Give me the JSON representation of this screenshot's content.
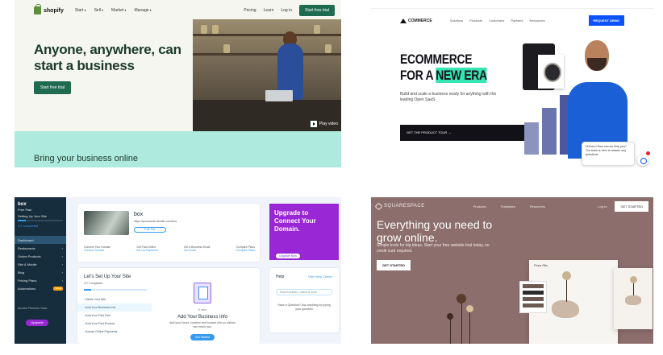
{
  "shopify": {
    "brand": "shopify",
    "nav": [
      "Start",
      "Sell",
      "Market",
      "Manage"
    ],
    "pricing": "Pricing",
    "learn": "Learn",
    "login": "Log in",
    "trial_small": "Start free trial",
    "headline": "Anyone, anywhere, can start a business",
    "cta": "Start free trial",
    "play": "Play video",
    "band": "Bring your business online",
    "colors": {
      "brand": "#5e8e3e",
      "button": "#1e6b52",
      "band": "#aeeade"
    }
  },
  "bigcommerce": {
    "brand": "COMMERCE",
    "nav": [
      "Solutions",
      "Products",
      "Customers",
      "Partners",
      "Resources"
    ],
    "demo": "REQUEST DEMO",
    "h1_line1": "ECOMMERCE",
    "h1_line2a": "FOR A ",
    "h1_line2b": "NEW ERA",
    "sub": "Build and scale a business ready for anything with the leading Open SaaS",
    "tour": "GET THE PRODUCT TOUR →",
    "chat": "Hi there! How can we help you? Our team is here to answer any questions.",
    "colors": {
      "accent": "#0d52ff",
      "highlight": "#36e4b4"
    }
  },
  "wix": {
    "site_name": "box",
    "site_sub": "Free Plan",
    "setup_label": "Setting Up Your Site",
    "setup_pct": "1/7 completed",
    "sidebar": [
      "Dashboard",
      "Restaurants",
      "Online Products",
      "Site & Mobile",
      "Blog",
      "Pricing Plans",
      "Automations"
    ],
    "sidebar_badge": "SALE",
    "premium": "Access Premium Tools",
    "upgrade": "Upgrade",
    "card_title": "box",
    "card_url": "https://yourname.wixsite.com/box",
    "edit_site": "Edit Site",
    "quick": [
      {
        "label": "Connect Your Domain",
        "link": "Connect Domain"
      },
      {
        "label": "Get Paid Online",
        "link": "Set Up Payments"
      },
      {
        "label": "Get a Business Email",
        "link": "Get Email"
      },
      {
        "label": "Compare Plans",
        "link": "Compare Plans"
      }
    ],
    "promo_title": "Upgrade to Connect Your Domain.",
    "promo_btn": "Upgrade Now",
    "setup_title": "Let's Set Up Your Site",
    "setup_progress": "1/7 Completed",
    "steps": [
      "Name Your Site",
      "Add Your Business Info",
      "Add Your First Post",
      "Add Your First Product",
      "Accept Online Payments"
    ],
    "content_kicker": "5 mins",
    "content_title": "Add Your Business Info",
    "content_desc": "Add your hours, location and contact info so visitors can reach you.",
    "content_btn": "Get Started",
    "help_title": "Help",
    "help_center": "Visit Help Center",
    "help_search": "Search articles, videos & more",
    "help_q": "Have a Question? Ask anything by typing your question"
  },
  "squarespace": {
    "brand": "SQUARESPACE",
    "nav": [
      "Products",
      "Templates",
      "Resources"
    ],
    "login": "Log In",
    "start": "GET STARTED",
    "hero": "Everything you need to grow online.",
    "sub": "Simple tools for big ideas. Start your free website trial today, no credit card required.",
    "get": "GET STARTED",
    "frame_title": "Flora Oils",
    "colors": {
      "bg": "#8c6e6c"
    }
  }
}
